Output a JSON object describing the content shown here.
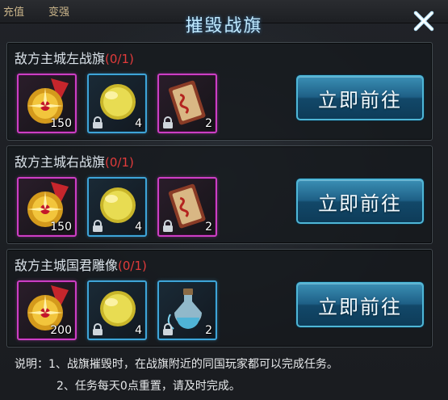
{
  "header": {
    "title": "摧毁战旗",
    "bg_tabs": [
      "充值",
      "变强"
    ]
  },
  "rows": [
    {
      "title": "敌方主城左战旗",
      "count": "(0/1)",
      "items": [
        {
          "icon": "golden-medal-icon",
          "qty": "150",
          "locked": false,
          "rarity": "purple"
        },
        {
          "icon": "gold-orb-icon",
          "qty": "4",
          "locked": true,
          "rarity": "blue"
        },
        {
          "icon": "scroll-card-icon",
          "qty": "2",
          "locked": true,
          "rarity": "purple"
        }
      ],
      "button": "立即前往"
    },
    {
      "title": "敌方主城右战旗",
      "count": "(0/1)",
      "items": [
        {
          "icon": "golden-medal-icon",
          "qty": "150",
          "locked": false,
          "rarity": "purple"
        },
        {
          "icon": "gold-orb-icon",
          "qty": "4",
          "locked": true,
          "rarity": "blue"
        },
        {
          "icon": "scroll-card-icon",
          "qty": "2",
          "locked": true,
          "rarity": "purple"
        }
      ],
      "button": "立即前往"
    },
    {
      "title": "敌方主城国君雕像",
      "count": "(0/1)",
      "items": [
        {
          "icon": "golden-medal-icon",
          "qty": "200",
          "locked": false,
          "rarity": "purple"
        },
        {
          "icon": "gold-orb-icon",
          "qty": "4",
          "locked": true,
          "rarity": "blue"
        },
        {
          "icon": "potion-bottle-icon",
          "qty": "2",
          "locked": true,
          "rarity": "blue"
        }
      ],
      "button": "立即前往"
    }
  ],
  "notes": {
    "line1": "说明：1、战旗摧毁时，在战旗附近的同国玩家都可以完成任务。",
    "line2": "2、任务每天0点重置，请及时完成。"
  },
  "colors": {
    "title": "#bfe9ff",
    "count": "#e23b3b",
    "purple_border": "#cc3fc4",
    "blue_border": "#3fa4d8",
    "button": "#1e5f86"
  }
}
